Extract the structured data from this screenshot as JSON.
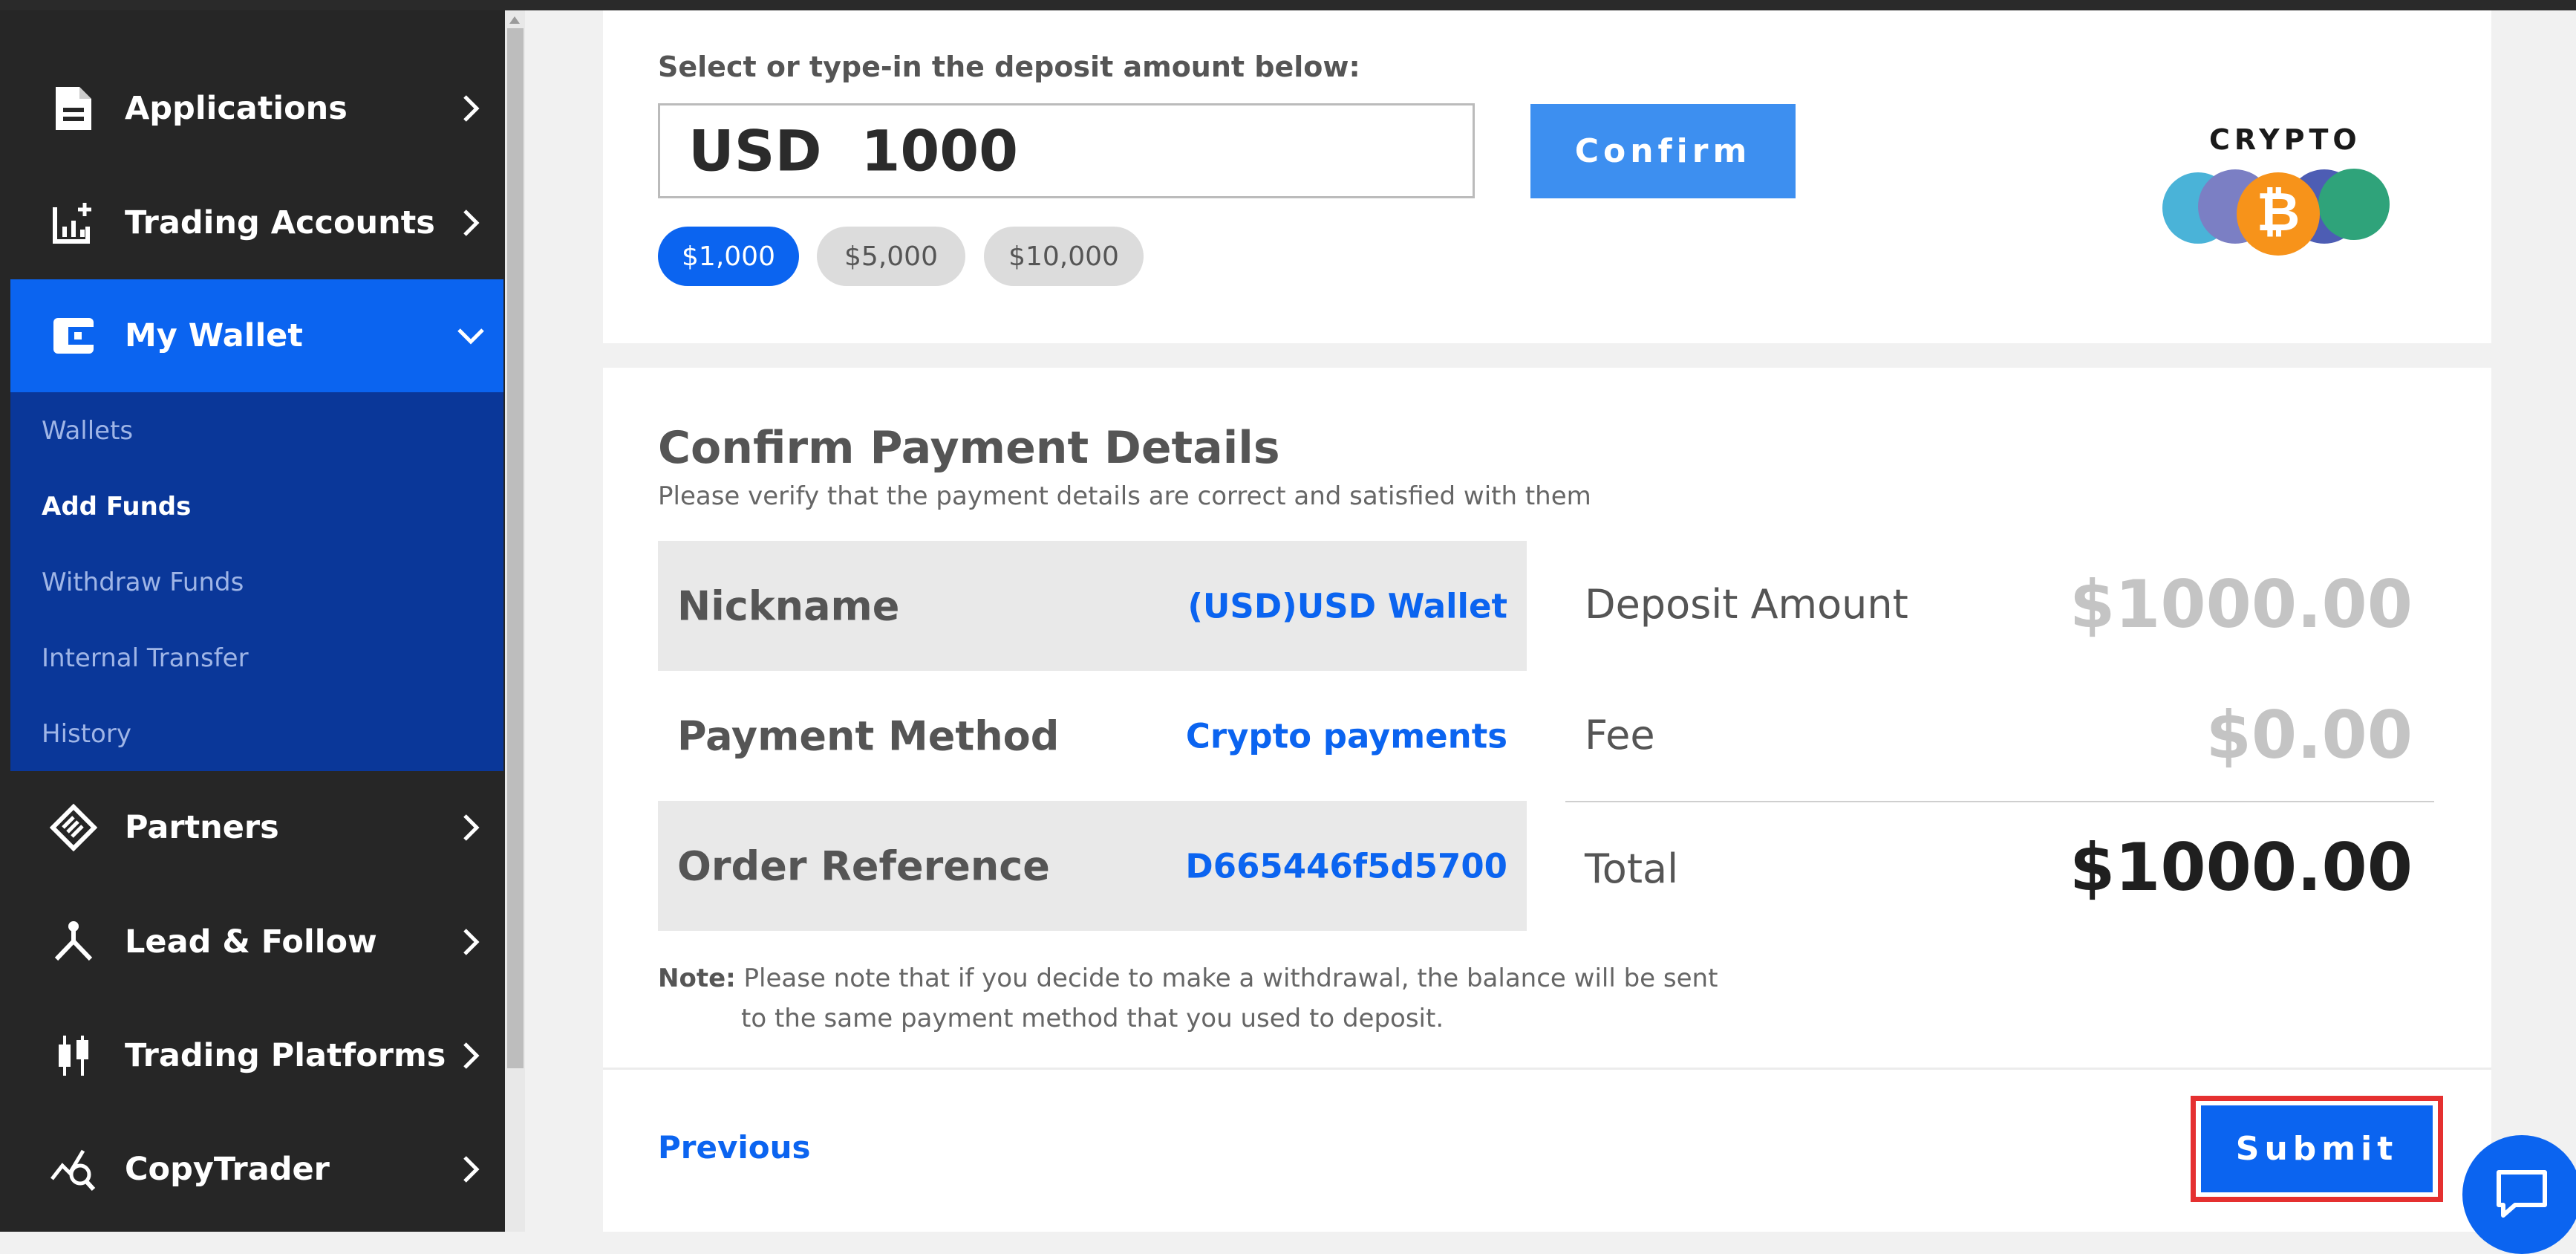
{
  "sidebar": {
    "items": [
      {
        "label": "Applications",
        "icon": "document-icon"
      },
      {
        "label": "Trading Accounts",
        "icon": "chart-add-icon"
      },
      {
        "label": "My Wallet",
        "icon": "wallet-icon"
      },
      {
        "label": "Partners",
        "icon": "handshake-icon"
      },
      {
        "label": "Lead & Follow",
        "icon": "branch-icon"
      },
      {
        "label": "Trading Platforms",
        "icon": "candlestick-icon"
      },
      {
        "label": "CopyTrader",
        "icon": "chart-search-icon"
      }
    ],
    "wallet_submenu": [
      "Wallets",
      "Add Funds",
      "Withdraw Funds",
      "Internal Transfer",
      "History"
    ],
    "active_item": "My Wallet",
    "current_subitem": "Add Funds"
  },
  "deposit": {
    "prompt": "Select or type-in the deposit amount below:",
    "amount_value": "USD  1000",
    "confirm_label": "Confirm",
    "presets": [
      "$1,000",
      "$5,000",
      "$10,000"
    ],
    "selected_preset": "$1,000",
    "logo_text": "CRYPTO"
  },
  "confirm": {
    "title": "Confirm Payment Details",
    "subtitle": "Please verify that the payment details are correct and satisfied with them",
    "details": [
      {
        "key": "Nickname",
        "value": "(USD)USD Wallet"
      },
      {
        "key": "Payment Method",
        "value": "Crypto payments"
      },
      {
        "key": "Order Reference",
        "value": "D665446f5d5700"
      }
    ],
    "amounts": [
      {
        "label": "Deposit Amount",
        "value": "$1000.00"
      },
      {
        "label": "Fee",
        "value": "$0.00"
      },
      {
        "label": "Total",
        "value": "$1000.00"
      }
    ],
    "note_label": "Note:",
    "note_line1": "Please note that if you decide to make a withdrawal, the balance will be sent",
    "note_line2": "to the same payment method that you used to deposit."
  },
  "footer": {
    "previous_label": "Previous",
    "submit_label": "Submit"
  },
  "colors": {
    "primary_blue": "#0b64f0",
    "sidebar_bg": "#262626",
    "submenu_bg": "#0a3799",
    "highlight_red": "#e53030"
  }
}
